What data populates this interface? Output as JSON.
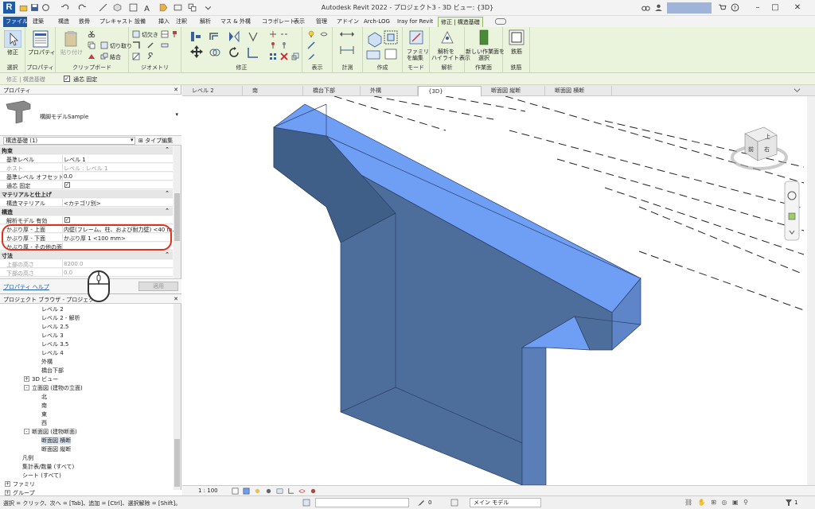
{
  "window": {
    "title": "Autodesk Revit 2022 - プロジェクト3 - 3D ビュー: {3D}"
  },
  "ribbon_tabs": [
    "建築",
    "構造",
    "鉄骨",
    "プレキャスト",
    "設備",
    "挿入",
    "注釈",
    "解析",
    "マス & 外構",
    "コラボレート",
    "表示",
    "管理",
    "アドイン",
    "Arch-LOG",
    "Iray for Revit",
    "修正 | 構造基礎"
  ],
  "file_tab": "ファイル",
  "ribbon": {
    "select_label": "修正",
    "select_group": "選択",
    "properties_label": "プロパティ",
    "properties_group": "プロパティ",
    "paste_label": "貼り付け",
    "cut_label": "切り取り",
    "join_label": "結合",
    "clipboard_group": "クリップボード",
    "cutout_label": "切欠き",
    "geometry_group": "ジオメトリ",
    "modify_group": "修正",
    "view_group": "表示",
    "measure_group": "計測",
    "create_group": "作成",
    "edit_family_label1": "ファミリ",
    "edit_family_label2": "を編集",
    "mode_group": "モード",
    "highlight_label1": "解析を",
    "highlight_label2": "ハイライト表示",
    "analysis_group": "解析",
    "new_workplane_label1": "新しい作業面を",
    "new_workplane_label2": "選択",
    "workplane_group": "作業面",
    "rebar_label": "鉄筋",
    "rebar_group": "鉄筋"
  },
  "optbar": {
    "context": "修正 | 構造基礎",
    "joint_label": "通芯 固定"
  },
  "properties": {
    "header": "プロパティ",
    "type_name": "構脚モデルSample",
    "instance_filter": "構造基礎 (1)",
    "type_edit": "タイプ編集",
    "rows": [
      {
        "k": "拘束",
        "v": "",
        "cat": true
      },
      {
        "k": "基準レベル",
        "v": "レベル 1"
      },
      {
        "k": "ホスト",
        "v": "レベル : レベル 1",
        "dim": true
      },
      {
        "k": "基準レベル オフセット",
        "v": "0.0"
      },
      {
        "k": "通芯 固定",
        "v": "",
        "check": true
      },
      {
        "k": "マテリアルと仕上げ",
        "v": "",
        "cat": true
      },
      {
        "k": "構造マテリアル",
        "v": "<カテゴリ別>"
      },
      {
        "k": "構造",
        "v": "",
        "cat": true
      },
      {
        "k": "解析モデル 有効",
        "v": "",
        "check": true
      },
      {
        "k": "かぶり厚 - 上面",
        "v": "内壁(フレーム、柱、および耐力壁) <40 m..."
      },
      {
        "k": "かぶり厚 - 下面",
        "v": "かぶり厚 1 <100 mm>"
      },
      {
        "k": "かぶり厚 - その他の面",
        "v": ""
      },
      {
        "k": "寸法",
        "v": "",
        "cat": true
      },
      {
        "k": "上部の高さ",
        "v": "8200.0",
        "dim": true
      },
      {
        "k": "下部の高さ",
        "v": "0.0",
        "dim": true
      }
    ],
    "help": "プロパティ ヘルプ",
    "apply": "適用"
  },
  "browser": {
    "header": "プロジェクト ブラウザ - プロジェクト3",
    "items": [
      {
        "label": "レベル 2",
        "indent": 3
      },
      {
        "label": "レベル 2 - 解析",
        "indent": 3
      },
      {
        "label": "レベル 2.5",
        "indent": 3
      },
      {
        "label": "レベル 3",
        "indent": 3
      },
      {
        "label": "レベル 3.5",
        "indent": 3
      },
      {
        "label": "レベル 4",
        "indent": 3
      },
      {
        "label": "外構",
        "indent": 3
      },
      {
        "label": "橋台下部",
        "indent": 3
      },
      {
        "label": "3D ビュー",
        "indent": 2,
        "exp": "+"
      },
      {
        "label": "立面図 (建物の立面)",
        "indent": 2,
        "exp": "-"
      },
      {
        "label": "北",
        "indent": 3
      },
      {
        "label": "南",
        "indent": 3
      },
      {
        "label": "東",
        "indent": 3
      },
      {
        "label": "西",
        "indent": 3
      },
      {
        "label": "断面図 (建物断面)",
        "indent": 2,
        "exp": "-"
      },
      {
        "label": "断面図 横断",
        "indent": 3,
        "sel": true
      },
      {
        "label": "断面図 縦断",
        "indent": 3
      },
      {
        "label": "凡例",
        "indent": 1
      },
      {
        "label": "集計表/数量 (すべて)",
        "indent": 1
      },
      {
        "label": "シート (すべて)",
        "indent": 1
      },
      {
        "label": "ファミリ",
        "indent": 0,
        "exp": "+"
      },
      {
        "label": "グループ",
        "indent": 0,
        "exp": "+"
      }
    ]
  },
  "view_tabs": [
    {
      "label": "レベル 2"
    },
    {
      "label": "南"
    },
    {
      "label": "橋台下部"
    },
    {
      "label": "外構"
    },
    {
      "label": "{3D}",
      "active": true
    },
    {
      "label": "断面図 縦断"
    },
    {
      "label": "断面図 横断"
    }
  ],
  "viewcube": {
    "top": "上",
    "front": "前",
    "right": "右"
  },
  "viewbar": {
    "scale": "1 : 100"
  },
  "statusbar": {
    "message": "選択 = クリック、次へ = [Tab]、追加 = [Ctrl]、選択解除 = [Shift]。",
    "coord": "0",
    "model": "メイン モデル",
    "filter_count": "1"
  },
  "colors": {
    "accent": "#1e5aa8",
    "ribbon_bg": "#eaf3dc",
    "highlight": "#e0301e",
    "solid_top": "#6f9ef5",
    "solid_side": "#4d6e9b"
  }
}
